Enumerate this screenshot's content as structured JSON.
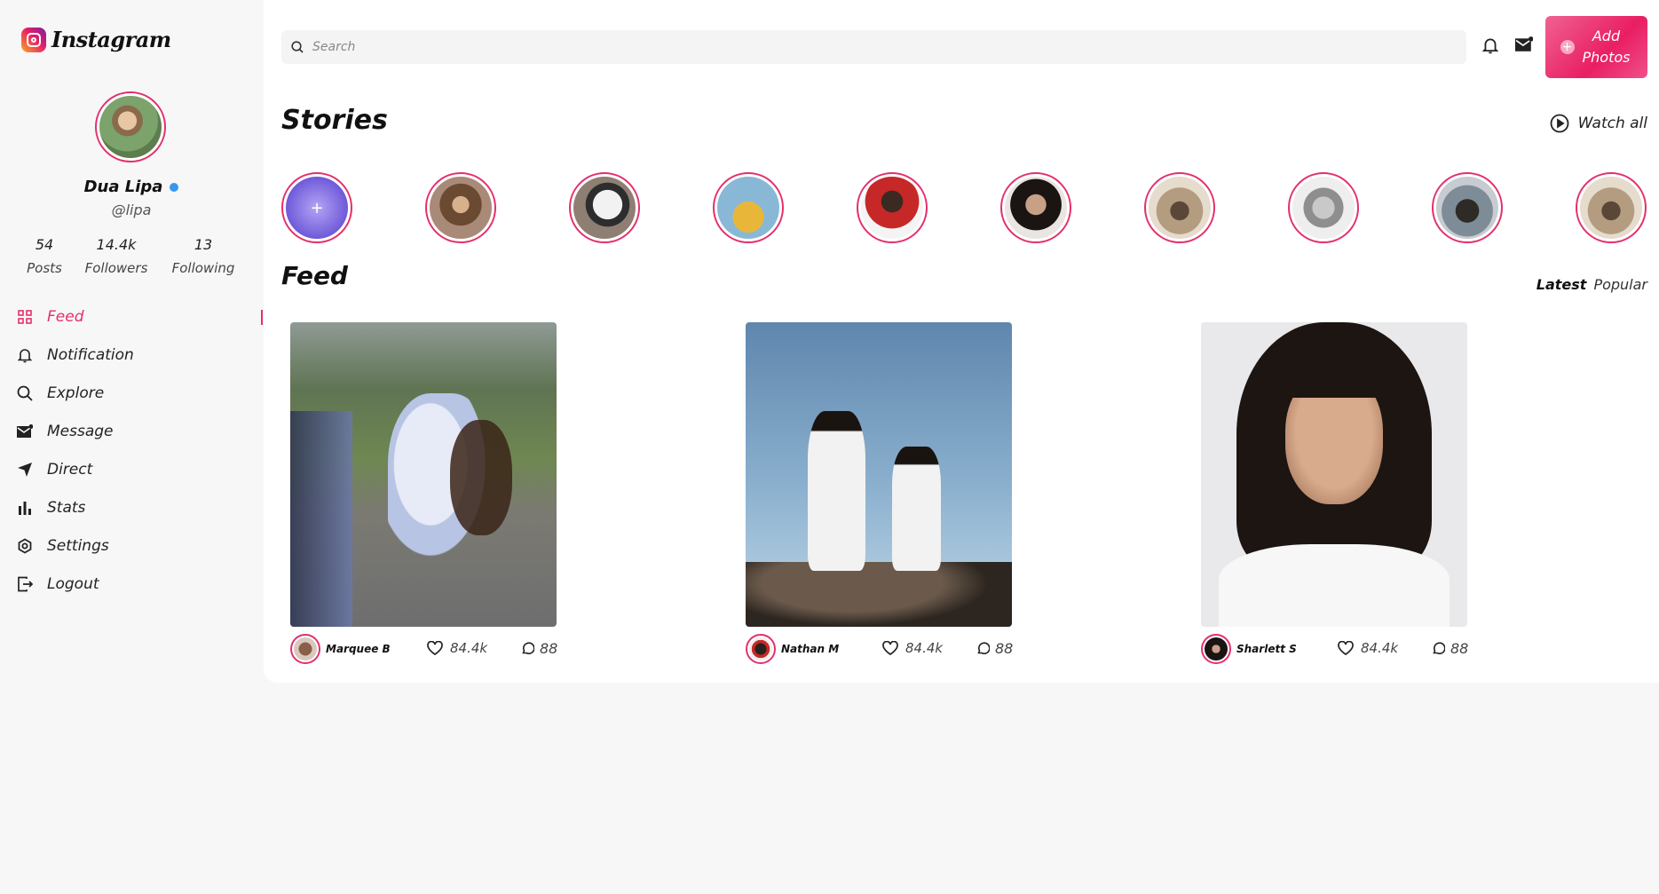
{
  "app": {
    "name": "Instagram"
  },
  "profile": {
    "name": "Dua Lipa",
    "handle": "@lipa",
    "stats": [
      {
        "value": "54",
        "label": "Posts"
      },
      {
        "value": "14.4k",
        "label": "Followers"
      },
      {
        "value": "13",
        "label": "Following"
      }
    ]
  },
  "nav": [
    {
      "label": "Feed",
      "icon": "grid-icon",
      "active": true
    },
    {
      "label": "Notification",
      "icon": "bell-icon"
    },
    {
      "label": "Explore",
      "icon": "search-icon"
    },
    {
      "label": "Message",
      "icon": "mail-icon"
    },
    {
      "label": "Direct",
      "icon": "send-icon"
    },
    {
      "label": "Stats",
      "icon": "bar-chart-icon"
    },
    {
      "label": "Settings",
      "icon": "settings-icon"
    },
    {
      "label": "Logout",
      "icon": "logout-icon"
    }
  ],
  "header": {
    "search_placeholder": "Search",
    "add_button_label": "Add Photos"
  },
  "stories": {
    "title": "Stories",
    "watch_all_label": "Watch all",
    "add_icon": "plus-icon"
  },
  "feed": {
    "title": "Feed",
    "tabs": [
      {
        "label": "Latest",
        "active": true
      },
      {
        "label": "Popular",
        "active": false
      }
    ],
    "posts": [
      {
        "author": "Marquee B",
        "likes": "84.4k",
        "comments": "88"
      },
      {
        "author": "Nathan M",
        "likes": "84.4k",
        "comments": "88"
      },
      {
        "author": "Sharlett S",
        "likes": "84.4k",
        "comments": "88"
      }
    ]
  },
  "colors": {
    "accent": "#e3306c",
    "verified": "#3897f0"
  }
}
